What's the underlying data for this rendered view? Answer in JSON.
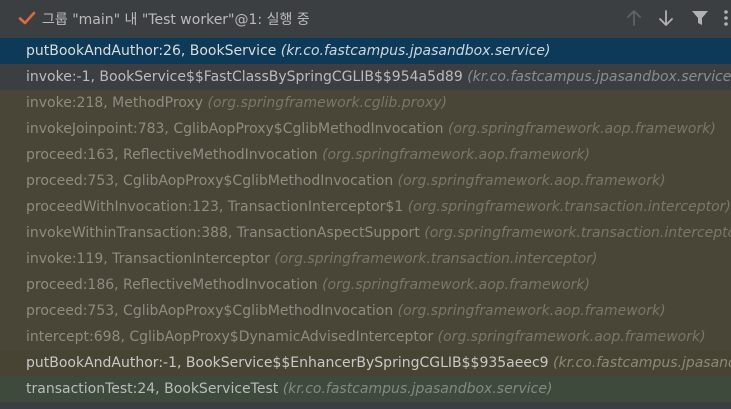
{
  "header": {
    "title": "그룹 \"main\" 내 \"Test worker\"@1: 실행 중",
    "icons": {
      "status": "checkmark-icon",
      "up": "arrow-up-icon",
      "down": "arrow-down-icon",
      "filter": "filter-icon",
      "menu": "more-vertical-icon"
    }
  },
  "colors": {
    "selected_row": "#0d3a58",
    "library_row": "#4a4637",
    "test_row": "#3d4a3c",
    "check_icon": "#e06a3a"
  },
  "frames": [
    {
      "method": "putBookAndAuthor:26, BookService",
      "package": "(kr.co.fastcampus.jpasandbox.service)",
      "kind": "selected"
    },
    {
      "method": "invoke:-1, BookService$$FastClassBySpringCGLIB$$954a5d89",
      "package": "(kr.co.fastcampus.jpasandbox.service)",
      "kind": "normal"
    },
    {
      "method": "invoke:218, MethodProxy",
      "package": "(org.springframework.cglib.proxy)",
      "kind": "lib"
    },
    {
      "method": "invokeJoinpoint:783, CglibAopProxy$CglibMethodInvocation",
      "package": "(org.springframework.aop.framework)",
      "kind": "lib"
    },
    {
      "method": "proceed:163, ReflectiveMethodInvocation",
      "package": "(org.springframework.aop.framework)",
      "kind": "lib"
    },
    {
      "method": "proceed:753, CglibAopProxy$CglibMethodInvocation",
      "package": "(org.springframework.aop.framework)",
      "kind": "lib"
    },
    {
      "method": "proceedWithInvocation:123, TransactionInterceptor$1",
      "package": "(org.springframework.transaction.interceptor)",
      "kind": "lib"
    },
    {
      "method": "invokeWithinTransaction:388, TransactionAspectSupport",
      "package": "(org.springframework.transaction.interceptor)",
      "kind": "lib"
    },
    {
      "method": "invoke:119, TransactionInterceptor",
      "package": "(org.springframework.transaction.interceptor)",
      "kind": "lib"
    },
    {
      "method": "proceed:186, ReflectiveMethodInvocation",
      "package": "(org.springframework.aop.framework)",
      "kind": "lib"
    },
    {
      "method": "proceed:753, CglibAopProxy$CglibMethodInvocation",
      "package": "(org.springframework.aop.framework)",
      "kind": "lib"
    },
    {
      "method": "intercept:698, CglibAopProxy$DynamicAdvisedInterceptor",
      "package": "(org.springframework.aop.framework)",
      "kind": "lib"
    },
    {
      "method": "putBookAndAuthor:-1, BookService$$EnhancerBySpringCGLIB$$935aeec9",
      "package": "(kr.co.fastcampus.jpasandbox.service)",
      "kind": "bright"
    },
    {
      "method": "transactionTest:24, BookServiceTest",
      "package": "(kr.co.fastcampus.jpasandbox.service)",
      "kind": "test"
    }
  ]
}
